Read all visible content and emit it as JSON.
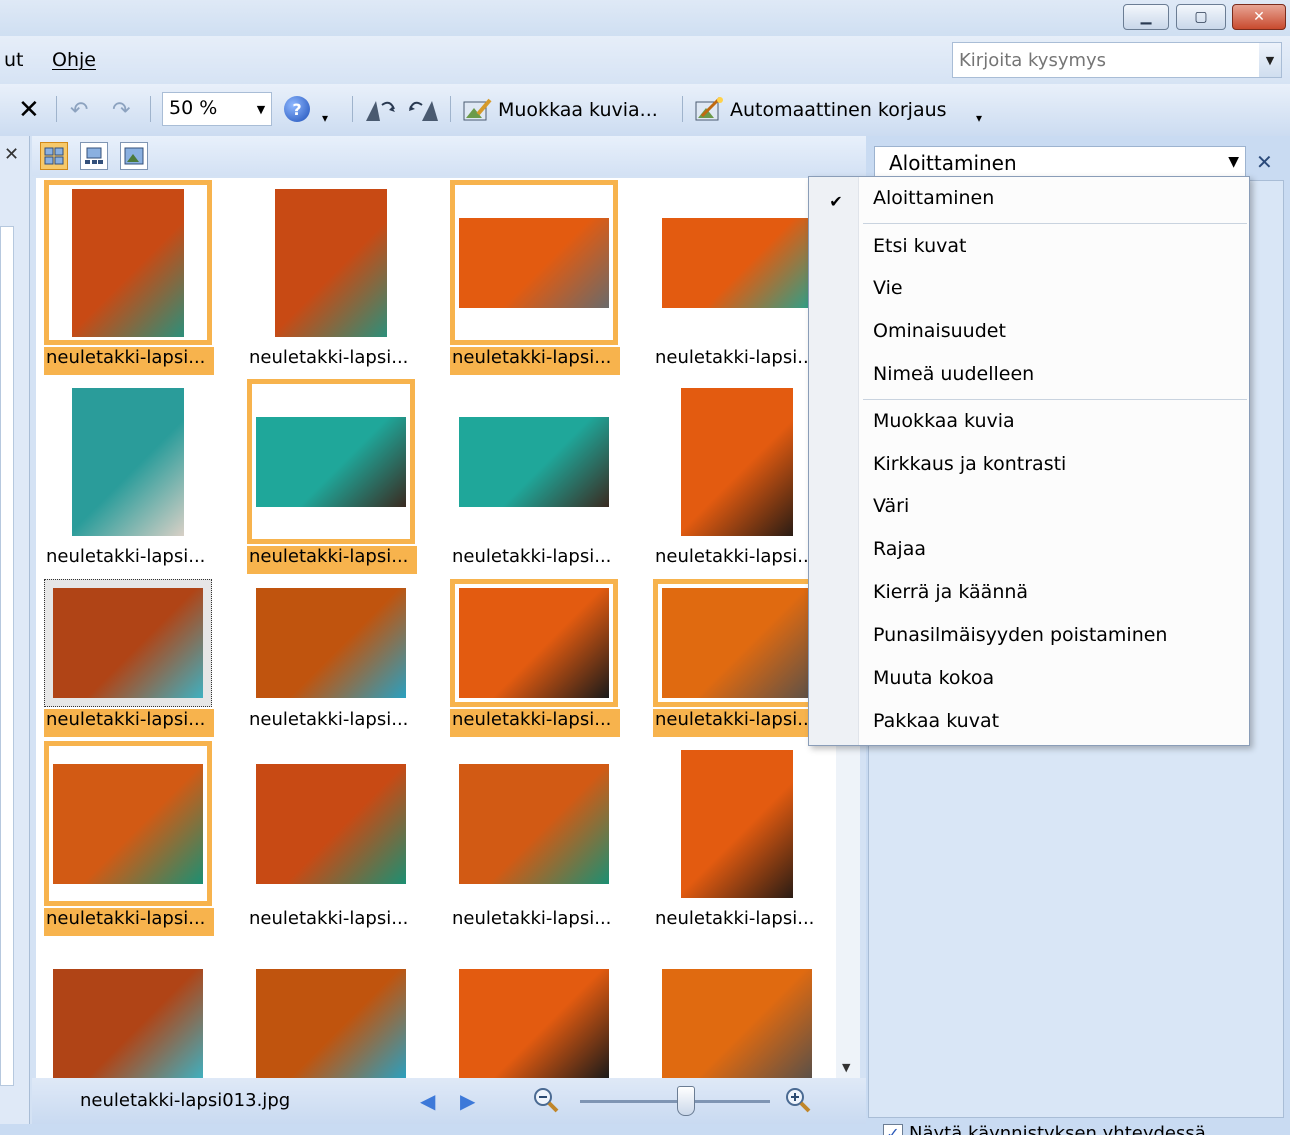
{
  "window": {
    "controls": [
      "minimize",
      "maximize",
      "close"
    ]
  },
  "menubar": {
    "items": [
      "ut",
      "Ohje"
    ]
  },
  "help_search": {
    "placeholder": "Kirjoita kysymys"
  },
  "toolbar": {
    "zoom_value": "50 %",
    "edit_pictures_label": "Muokkaa kuvia...",
    "auto_correct_label": "Automaattinen korjaus"
  },
  "thumbnails": [
    {
      "caption": "neuletakki-lapsi...",
      "selected": true,
      "colors": [
        "#c84a14",
        "#2c8f7a"
      ]
    },
    {
      "caption": "neuletakki-lapsi...",
      "selected": false,
      "colors": [
        "#c84a14",
        "#2c8f7a"
      ]
    },
    {
      "caption": "neuletakki-lapsi...",
      "selected": true,
      "colors": [
        "#e35b10",
        "#6a6a6a"
      ]
    },
    {
      "caption": "neuletakki-lapsi..",
      "selected": false,
      "colors": [
        "#e35b10",
        "#2ca08a"
      ]
    },
    {
      "caption": "neuletakki-lapsi...",
      "selected": false,
      "colors": [
        "#2a9c9a",
        "#d8d0c6"
      ]
    },
    {
      "caption": "neuletakki-lapsi...",
      "selected": true,
      "colors": [
        "#1fa79a",
        "#3a2a20"
      ]
    },
    {
      "caption": "neuletakki-lapsi...",
      "selected": false,
      "colors": [
        "#1fa79a",
        "#3a2a20"
      ]
    },
    {
      "caption": "neuletakki-lapsi..",
      "selected": false,
      "colors": [
        "#e35b10",
        "#2a1c14"
      ]
    },
    {
      "caption": "neuletakki-lapsi...",
      "selected": true,
      "focus": true,
      "colors": [
        "#b04416",
        "#3fb0c0"
      ]
    },
    {
      "caption": "neuletakki-lapsi...",
      "selected": false,
      "colors": [
        "#c0540e",
        "#2aa0c0"
      ]
    },
    {
      "caption": "neuletakki-lapsi...",
      "selected": true,
      "colors": [
        "#e35b10",
        "#1a1a1a"
      ]
    },
    {
      "caption": "neuletakki-lapsi..",
      "selected": true,
      "colors": [
        "#e06a10",
        "#5a5048"
      ]
    },
    {
      "caption": "neuletakki-lapsi...",
      "selected": true,
      "colors": [
        "#d25a14",
        "#1c8f72"
      ]
    },
    {
      "caption": "neuletakki-lapsi...",
      "selected": false,
      "colors": [
        "#c84a14",
        "#1c8f72"
      ]
    },
    {
      "caption": "neuletakki-lapsi...",
      "selected": false,
      "colors": [
        "#d25a14",
        "#1c8f72"
      ]
    },
    {
      "caption": "neuletakki-lapsi...",
      "selected": false,
      "colors": [
        "#e35b10",
        "#2a1c14"
      ]
    },
    {
      "caption": "",
      "selected": false,
      "colors": [
        "#b04416",
        "#3fb0c0"
      ]
    },
    {
      "caption": "",
      "selected": false,
      "colors": [
        "#c0540e",
        "#2aa0c0"
      ]
    },
    {
      "caption": "",
      "selected": false,
      "colors": [
        "#e35b10",
        "#1a1a1a"
      ]
    },
    {
      "caption": "",
      "selected": false,
      "colors": [
        "#e06a10",
        "#5a5048"
      ]
    }
  ],
  "statusbar": {
    "filename": "neuletakki-lapsi013.jpg"
  },
  "task_pane": {
    "title": "Aloittaminen",
    "show_at_startup_label": "Näytä käynnistyksen yhteydessä",
    "show_at_startup_checked": true
  },
  "dropdown": {
    "items": [
      {
        "label": "Aloittaminen",
        "checked": true
      },
      {
        "label": "Etsi kuvat"
      },
      {
        "label": "Vie"
      },
      {
        "label": "Ominaisuudet"
      },
      {
        "label": "Nimeä uudelleen"
      },
      {
        "label": "Muokkaa kuvia"
      },
      {
        "label": "Kirkkaus ja kontrasti"
      },
      {
        "label": "Väri"
      },
      {
        "label": "Rajaa"
      },
      {
        "label": "Kierrä ja käännä"
      },
      {
        "label": "Punasilmäisyyden poistaminen"
      },
      {
        "label": "Muuta kokoa"
      },
      {
        "label": "Pakkaa kuvat"
      }
    ]
  },
  "colors": {
    "selection": "#f7b34d",
    "frame": "#c9dbf2",
    "accent": "#3d79d9"
  }
}
